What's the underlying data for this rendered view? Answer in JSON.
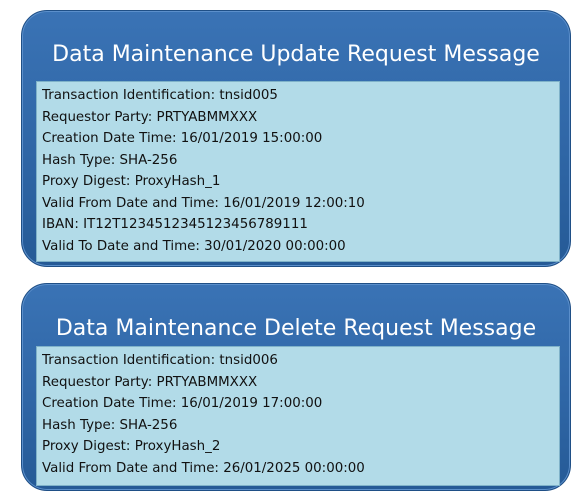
{
  "update_message": {
    "title": "Data Maintenance Update Request Message",
    "lines": [
      "Transaction Identification: tnsid005",
      "Requestor Party: PRTYABMMXXX",
      "Creation Date Time: 16/01/2019 15:00:00",
      "Hash Type: SHA-256",
      "Proxy Digest: ProxyHash_1",
      "Valid From Date and Time: 16/01/2019 12:00:10",
      "IBAN: IT12T1234512345123456789111",
      "Valid To Date and Time: 30/01/2020 00:00:00"
    ]
  },
  "delete_message": {
    "title": "Data Maintenance Delete Request Message",
    "lines": [
      "Transaction Identification: tnsid006",
      "Requestor Party: PRTYABMMXXX",
      "Creation Date Time: 16/01/2019 17:00:00",
      "Hash Type: SHA-256",
      "Proxy Digest: ProxyHash_2",
      "Valid From Date and Time: 26/01/2025 00:00:00"
    ]
  },
  "colors": {
    "card_blue": "#2f66a6",
    "field_box": "#b2dbe8",
    "title_text": "#ffffff"
  }
}
